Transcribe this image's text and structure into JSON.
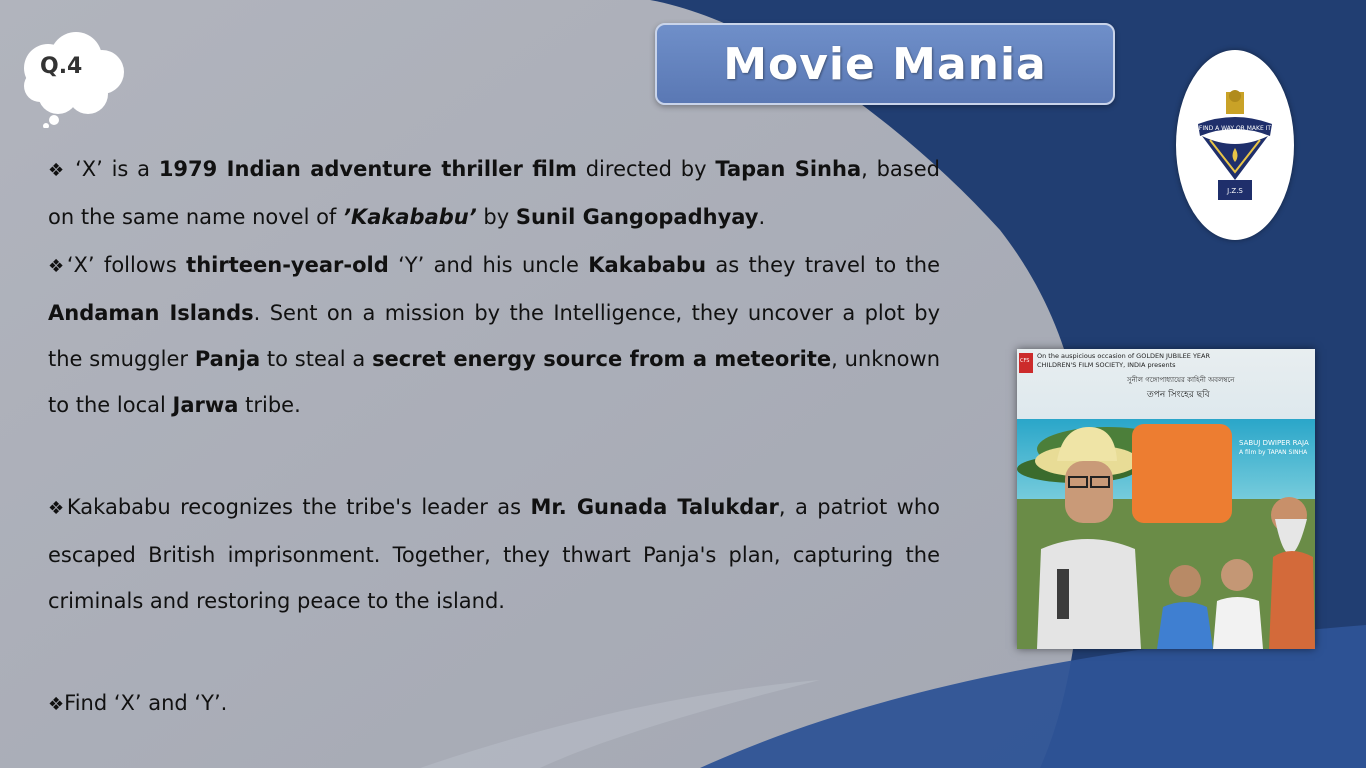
{
  "question_number": "Q.4",
  "title": "Movie Mania",
  "logo": {
    "name": "school-emblem",
    "motto": "FIND A WAY OR MAKE IT",
    "initials": "J.Z.S"
  },
  "paragraphs": [
    {
      "segments": [
        {
          "text": "‘X’ is a ",
          "bold": false
        },
        {
          "text": "1979 Indian adventure thriller film",
          "bold": true
        },
        {
          "text": " directed by ",
          "bold": false
        },
        {
          "text": "Tapan Sinha",
          "bold": true
        },
        {
          "text": ", based on the same name novel of ",
          "bold": false
        },
        {
          "text": "’Kakababu’",
          "bold": true,
          "italic": true
        },
        {
          "text": " by ",
          "bold": false
        },
        {
          "text": "Sunil Gangopadhyay",
          "bold": true
        },
        {
          "text": ".",
          "bold": false
        }
      ]
    },
    {
      "segments": [
        {
          "text": "‘X’ follows ",
          "bold": false
        },
        {
          "text": "thirteen-year-old",
          "bold": true
        },
        {
          "text": " ‘Y’ and his uncle ",
          "bold": false
        },
        {
          "text": "Kakababu",
          "bold": true
        },
        {
          "text": " as they travel to the ",
          "bold": false
        },
        {
          "text": "Andaman Islands",
          "bold": true
        },
        {
          "text": ". Sent on a mission by the Intelligence, they uncover a plot by the smuggler ",
          "bold": false
        },
        {
          "text": "Panja",
          "bold": true
        },
        {
          "text": " to steal a ",
          "bold": false
        },
        {
          "text": "secret energy source from a meteorite",
          "bold": true
        },
        {
          "text": ", unknown to the local ",
          "bold": false
        },
        {
          "text": "Jarwa",
          "bold": true
        },
        {
          "text": " tribe.",
          "bold": false
        }
      ]
    },
    {
      "segments": [
        {
          "text": "Kakababu recognizes the tribe's leader as ",
          "bold": false
        },
        {
          "text": "Mr. Gunada Talukdar",
          "bold": true
        },
        {
          "text": ", a patriot who escaped British imprisonment. Together, they thwart Panja's plan, capturing the criminals and restoring peace to the island.",
          "bold": false
        }
      ]
    },
    {
      "segments": [
        {
          "text": "Find ‘X’ and ‘Y’.",
          "bold": false
        }
      ]
    }
  ],
  "bullet_glyph": "❖",
  "poster": {
    "top_line_1": "On the auspicious occasion of GOLDEN JUBILEE YEAR",
    "top_line_2": "CHILDREN'S FILM SOCIETY, INDIA presents",
    "bengali_line_1": "সুনীল গঙ্গোপাধ্যায়ের কাহিনী অবলম্বনে",
    "bengali_line_2": "তপন সিংহের ছবি",
    "film_title": "SABUJ DWIPER RAJA",
    "credit": "A film by TAPAN SINHA",
    "badge": "CFS"
  },
  "colors": {
    "page_light": "#a9adb8",
    "page_dark": "#1f3a6a",
    "title_box": "#6081c0",
    "overlay_box": "#ed7d31"
  }
}
